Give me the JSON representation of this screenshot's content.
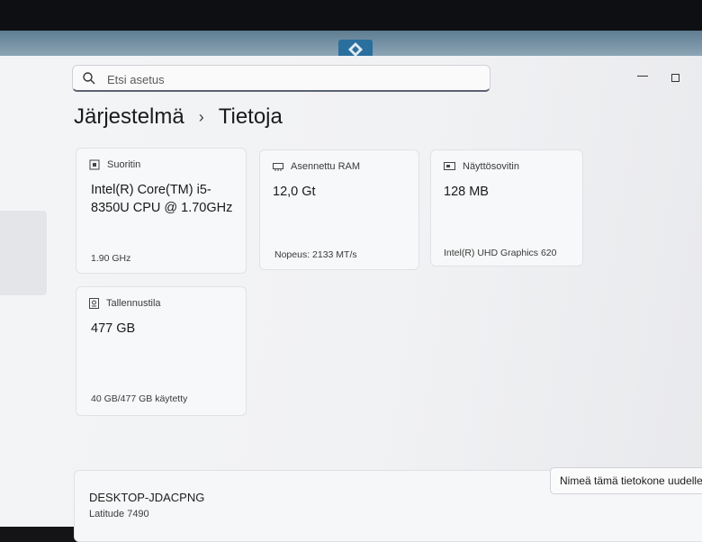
{
  "search": {
    "placeholder": "Etsi asetus"
  },
  "breadcrumb": {
    "parent": "Järjestelmä",
    "separator": "›",
    "current": "Tietoja"
  },
  "specs": {
    "processor": {
      "label": "Suoritin",
      "value": "Intel(R) Core(TM) i5-8350U CPU @ 1.70GHz",
      "sub": "1.90 GHz",
      "icon": "cpu-icon"
    },
    "ram": {
      "label": "Asennettu RAM",
      "value": "12,0 Gt",
      "sub": "Nopeus: 2133 MT/s",
      "icon": "ram-icon"
    },
    "gpu": {
      "label": "Näyttösovitin",
      "value": "128 MB",
      "sub": "Intel(R) UHD Graphics 620",
      "icon": "display-adapter-icon"
    },
    "storage": {
      "label": "Tallennustila",
      "value": "477 GB",
      "sub": "40 GB/477 GB käytetty",
      "icon": "storage-icon"
    }
  },
  "device": {
    "name": "DESKTOP-JDACPNG",
    "model": "Latitude 7490",
    "rename_label": "Nimeä tämä tietokone uudelleen"
  }
}
